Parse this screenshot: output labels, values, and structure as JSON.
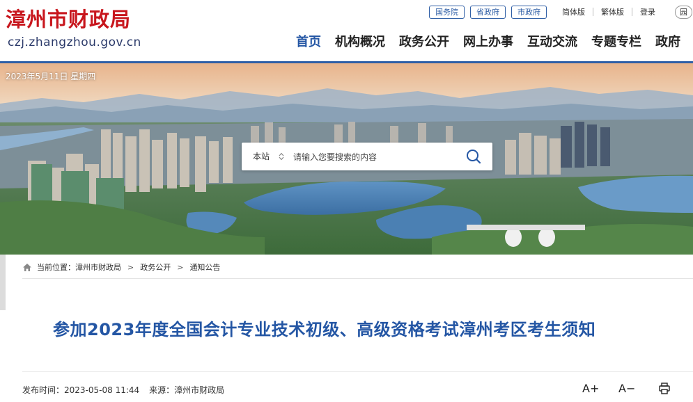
{
  "header": {
    "site_title": "漳州市财政局",
    "domain": "czj.zhangzhou.gov.cn",
    "top_links": [
      "国务院",
      "省政府",
      "市政府"
    ],
    "lang_links": [
      "简体版",
      "繁体版"
    ],
    "login": "登录",
    "elder_mode": "园"
  },
  "nav": {
    "items": [
      "首页",
      "机构概况",
      "政务公开",
      "网上办事",
      "互动交流",
      "专题专栏",
      "政府"
    ],
    "active": "首页"
  },
  "banner": {
    "date": "2023年5月11日 星期四",
    "search": {
      "scope": "本站",
      "placeholder": "请输入您要搜索的内容"
    }
  },
  "breadcrumb": {
    "label": "当前位置：",
    "items": [
      "漳州市财政局",
      "政务公开",
      "通知公告"
    ],
    "separator": ">"
  },
  "article": {
    "title": "参加2023年度全国会计专业技术初级、高级资格考试漳州考区考生须知",
    "publish_label": "发布时间：",
    "publish_time": "2023-05-08 11:44",
    "source_label": "来源：",
    "source": "漳州市财政局"
  },
  "tools": {
    "font_increase": "A+",
    "font_decrease": "A−"
  },
  "colors": {
    "brand_red": "#c8161d",
    "primary_blue": "#2456a4",
    "nav_active": "#2456a4"
  },
  "icons": {
    "home": "home-icon",
    "search": "search-icon",
    "print": "print-icon",
    "scope_toggle": "sort-arrows-icon"
  }
}
